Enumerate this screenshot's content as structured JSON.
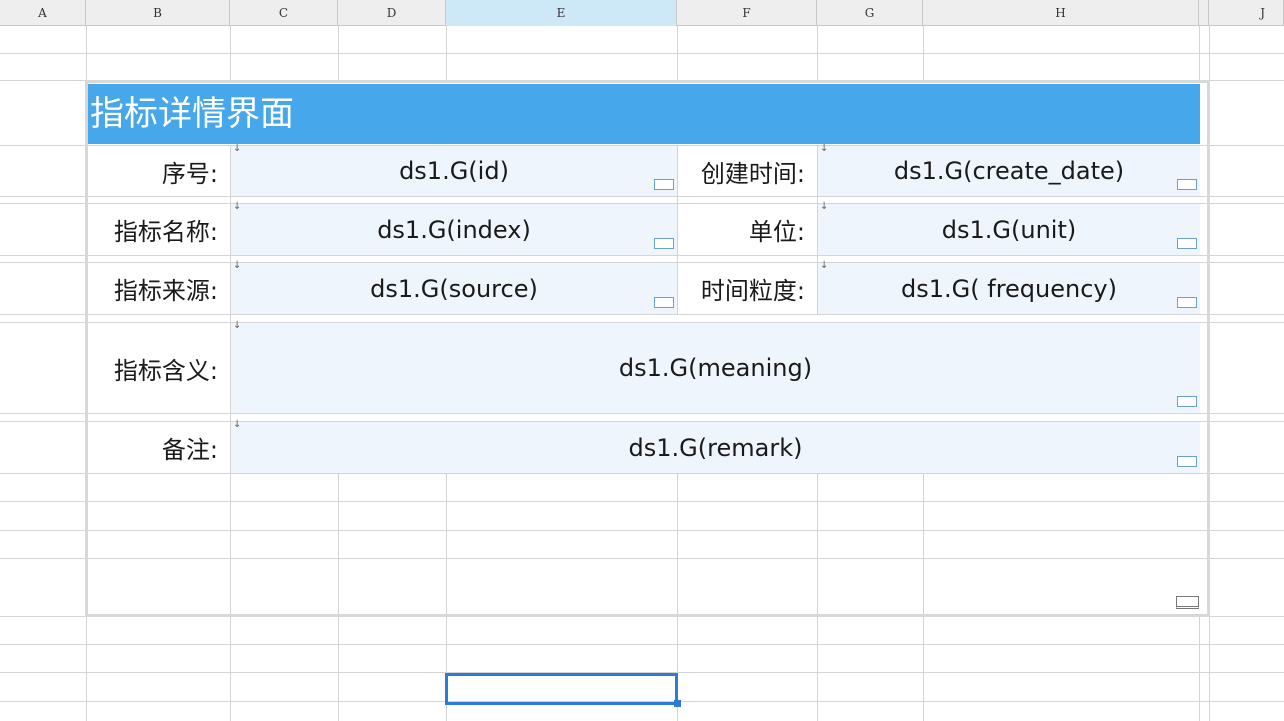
{
  "columns": [
    "A",
    "B",
    "C",
    "D",
    "E",
    "F",
    "G",
    "H",
    "J"
  ],
  "selected_column": "E",
  "report": {
    "title": "指标详情界面",
    "fields": [
      {
        "label": "序号:",
        "value": "ds1.G(id)"
      },
      {
        "label": "创建时间:",
        "value": "ds1.G(create_date)"
      },
      {
        "label": "指标名称:",
        "value": "ds1.G(index)"
      },
      {
        "label": "单位:",
        "value": "ds1.G(unit)"
      },
      {
        "label": "指标来源:",
        "value": "ds1.G(source)"
      },
      {
        "label": "时间粒度:",
        "value": "ds1.G( frequency)"
      },
      {
        "label": "指标含义:",
        "value": "ds1.G(meaning)"
      },
      {
        "label": "备注:",
        "value": "ds1.G(remark)"
      }
    ]
  },
  "colors": {
    "title_bg": "#46a7ea",
    "value_bg": "#eef5fc",
    "selection": "#2e7bd6",
    "header_selected": "#cde8f6"
  }
}
